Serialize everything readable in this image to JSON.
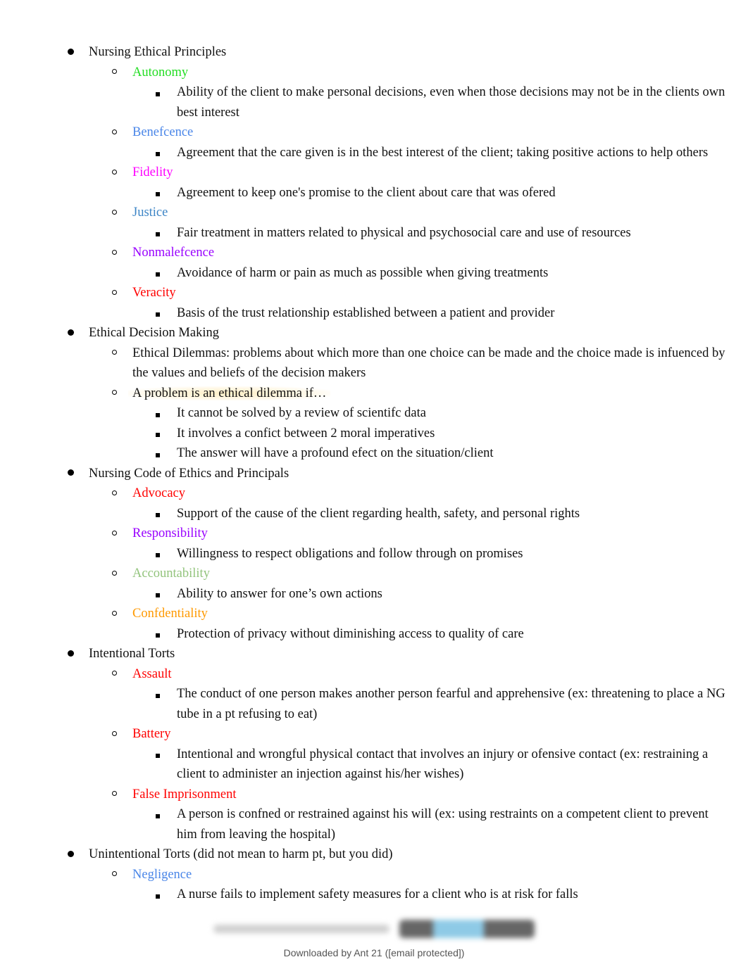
{
  "sections": [
    {
      "title": "Nursing Ethical Principles",
      "items": [
        {
          "label": "Autonomy",
          "color": "#22dd22",
          "details": [
            "Ability of the client to make personal decisions, even when those decisions may not be in the clients own best interest"
          ]
        },
        {
          "label": "Benefcence",
          "color": "#4a86e8",
          "details": [
            "Agreement that the care given is in the best interest of the client; taking positive actions to help others"
          ]
        },
        {
          "label": "Fidelity",
          "color": "#ff00ff",
          "details": [
            "Agreement to keep one's promise to the client about care that was ofered"
          ]
        },
        {
          "label": "Justice",
          "color": "#3d85c6",
          "details": [
            "Fair treatment in matters related to physical and psychosocial care and use of resources"
          ]
        },
        {
          "label": "Nonmalefcence",
          "color": "#9900ff",
          "details": [
            "Avoidance of harm or pain as much as possible when giving treatments"
          ]
        },
        {
          "label": "Veracity",
          "color": "#ff0000",
          "details": [
            "Basis of the trust relationship established between a patient and provider"
          ]
        }
      ]
    },
    {
      "title": "Ethical Decision Making",
      "items": [
        {
          "label": "Ethical Dilemmas: problems about which more than one choice can be made and the choice made is infuenced by the values and beliefs of the decision makers",
          "color": "#111111",
          "details": []
        },
        {
          "label": "A problem is an ethical dilemma if…",
          "color": "#111111",
          "highlighted": true,
          "details": [
            "It cannot be solved by a review of scientifc data",
            "It involves a confict between 2 moral imperatives",
            "The answer will have a profound efect on the situation/client"
          ]
        }
      ]
    },
    {
      "title": "Nursing Code of Ethics and Principals",
      "items": [
        {
          "label": "Advocacy",
          "color": "#ff0000",
          "details": [
            "Support of the cause of the client regarding health, safety, and personal rights"
          ]
        },
        {
          "label": "Responsibility",
          "color": "#9900ff",
          "details": [
            "Willingness to respect obligations and follow through on promises"
          ]
        },
        {
          "label": "Accountability",
          "color": "#93c47d",
          "details": [
            "Ability to answer for one’s own actions"
          ]
        },
        {
          "label": "Confdentiality",
          "color": "#ff9900",
          "details": [
            "Protection of privacy without diminishing access to quality of care"
          ]
        }
      ]
    },
    {
      "title": "Intentional Torts",
      "items": [
        {
          "label": "Assault",
          "color": "#ff0000",
          "details": [
            "The conduct of one person makes another person fearful and apprehensive (ex: threatening to place a NG tube in a pt refusing to eat)"
          ]
        },
        {
          "label": "Battery",
          "color": "#ff0000",
          "details": [
            "Intentional and wrongful physical contact that involves an injury or ofensive contact (ex: restraining a client to administer an injection against his/her wishes)"
          ]
        },
        {
          "label": "False Imprisonment",
          "color": "#ff0000",
          "details": [
            "A person is confned or restrained against his will (ex: using restraints on a competent client to prevent him from leaving the hospital)"
          ]
        }
      ]
    },
    {
      "title": "Unintentional Torts (did not mean to harm pt, but you did)",
      "items": [
        {
          "label": "Negligence",
          "color": "#4a86e8",
          "details": [
            "A nurse fails to implement safety measures for a client who is at risk for falls"
          ]
        }
      ]
    }
  ],
  "footer": {
    "download_note": "Downloaded by Ant 21 ([email protected])"
  }
}
